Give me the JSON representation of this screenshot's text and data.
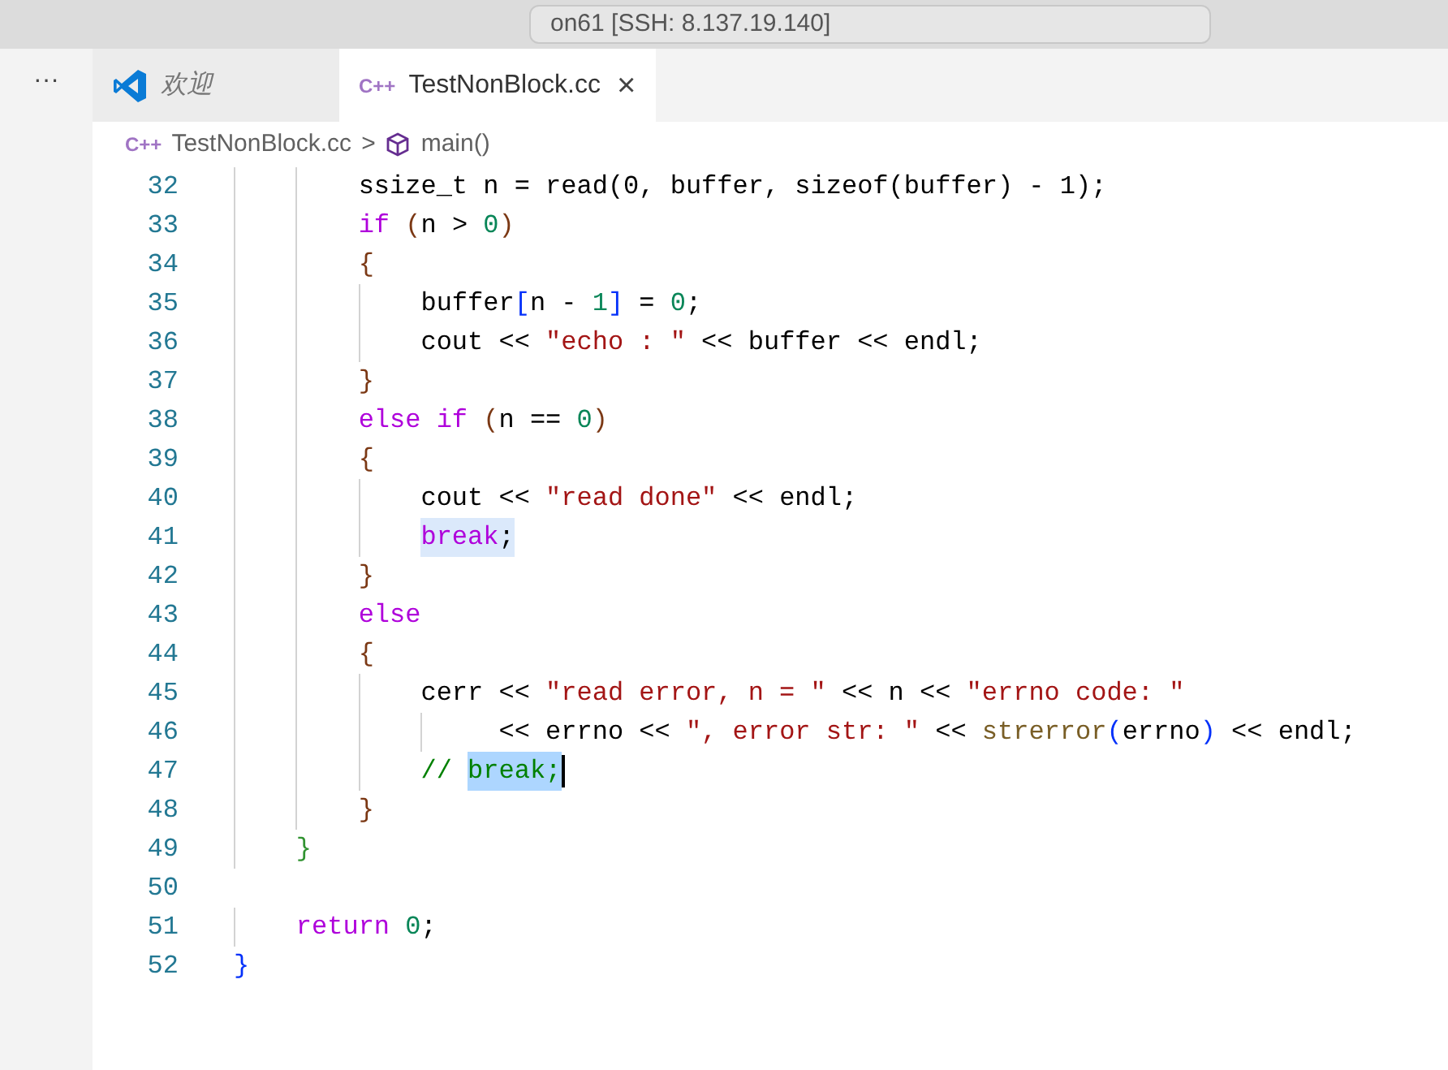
{
  "title_bar": {
    "search": "on61 [SSH: 8.137.19.140]"
  },
  "tabs": [
    {
      "label": "欢迎",
      "kind": "welcome",
      "selected": false,
      "preview": true
    },
    {
      "label": "TestNonBlock.cc",
      "kind": "cpp",
      "icon_text": "C++",
      "selected": true,
      "preview": false,
      "close": "×"
    }
  ],
  "more": "···",
  "breadcrumb": [
    {
      "label": "TestNonBlock.cc",
      "kind": "cpp",
      "icon_text": "C++"
    },
    {
      "label": "main()",
      "kind": "symbol"
    }
  ],
  "breadcrumb_sep": ">",
  "lines": [
    {
      "number": "32",
      "tokens": [
        {
          "text": "        ssize_t n = read(0, buffer, sizeof(buffer) - 1);",
          "kind": "plain"
        }
      ]
    },
    {
      "number": "33",
      "tokens": [
        {
          "text": "        if ",
          "kind": "kw"
        },
        {
          "text": "(",
          "kind": "b3"
        },
        {
          "text": "n > ",
          "kind": "plain"
        },
        {
          "text": "0",
          "kind": "num"
        },
        {
          "text": ")",
          "kind": "b3"
        }
      ]
    },
    {
      "number": "34",
      "tokens": [
        {
          "text": "        {",
          "kind": "b3"
        }
      ]
    },
    {
      "number": "35",
      "tokens": [
        {
          "text": "            buffer",
          "kind": "plain"
        },
        {
          "text": "[",
          "kind": "b1"
        },
        {
          "text": "n - ",
          "kind": "plain"
        },
        {
          "text": "1",
          "kind": "num"
        },
        {
          "text": "]",
          "kind": "b1"
        },
        {
          "text": " = ",
          "kind": "plain"
        },
        {
          "text": "0",
          "kind": "num"
        },
        {
          "text": ";",
          "kind": "plain"
        }
      ]
    },
    {
      "number": "36",
      "tokens": [
        {
          "text": "            cout << ",
          "kind": "plain"
        },
        {
          "text": "\"echo : \"",
          "kind": "str"
        },
        {
          "text": " << buffer << endl;",
          "kind": "plain"
        }
      ]
    },
    {
      "number": "37",
      "tokens": [
        {
          "text": "        }",
          "kind": "b3"
        }
      ]
    },
    {
      "number": "38",
      "tokens": [
        {
          "text": "        else if ",
          "kind": "kw"
        },
        {
          "text": "(",
          "kind": "b3"
        },
        {
          "text": "n == ",
          "kind": "plain"
        },
        {
          "text": "0",
          "kind": "num"
        },
        {
          "text": ")",
          "kind": "b3"
        }
      ]
    },
    {
      "number": "39",
      "tokens": [
        {
          "text": "        {",
          "kind": "b3"
        }
      ]
    },
    {
      "number": "40",
      "tokens": [
        {
          "text": "            cout << ",
          "kind": "plain"
        },
        {
          "text": "\"read done\"",
          "kind": "str"
        },
        {
          "text": " << endl;",
          "kind": "plain"
        }
      ]
    },
    {
      "number": "41",
      "tokens": [
        {
          "text": "            break",
          "kind": "kw",
          "highlighted": true
        },
        {
          "text": ";",
          "kind": "plain",
          "highlighted": true
        }
      ]
    },
    {
      "number": "42",
      "tokens": [
        {
          "text": "        }",
          "kind": "b3"
        }
      ]
    },
    {
      "number": "43",
      "tokens": [
        {
          "text": "        else",
          "kind": "kw"
        }
      ]
    },
    {
      "number": "44",
      "tokens": [
        {
          "text": "        {",
          "kind": "b3"
        }
      ]
    },
    {
      "number": "45",
      "tokens": [
        {
          "text": "            cerr << ",
          "kind": "plain"
        },
        {
          "text": "\"read error, n = \"",
          "kind": "str"
        },
        {
          "text": " << n << ",
          "kind": "plain"
        },
        {
          "text": "\"errno code: \"",
          "kind": "str"
        }
      ]
    },
    {
      "number": "46",
      "tokens": [
        {
          "text": "                 << errno << ",
          "kind": "plain"
        },
        {
          "text": "\", error str: \"",
          "kind": "str"
        },
        {
          "text": " << ",
          "kind": "plain"
        },
        {
          "text": "strerror",
          "kind": "fn"
        },
        {
          "text": "(",
          "kind": "b1"
        },
        {
          "text": "errno",
          "kind": "plain"
        },
        {
          "text": ")",
          "kind": "b1"
        },
        {
          "text": " << endl;",
          "kind": "plain"
        }
      ]
    },
    {
      "number": "47",
      "cursor": true,
      "tokens": [
        {
          "text": "            // ",
          "kind": "comment"
        },
        {
          "text": "break;",
          "kind": "comment",
          "text_selected": true
        }
      ]
    },
    {
      "number": "48",
      "tokens": [
        {
          "text": "        }",
          "kind": "b3"
        }
      ]
    },
    {
      "number": "49",
      "tokens": [
        {
          "text": "    }",
          "kind": "b2"
        }
      ]
    },
    {
      "number": "50"
    },
    {
      "number": "51",
      "tokens": [
        {
          "text": "    return ",
          "kind": "kw"
        },
        {
          "text": "0",
          "kind": "num"
        },
        {
          "text": ";",
          "kind": "plain"
        }
      ]
    },
    {
      "number": "52",
      "tokens": [
        {
          "text": "}",
          "kind": "b1"
        }
      ]
    }
  ]
}
